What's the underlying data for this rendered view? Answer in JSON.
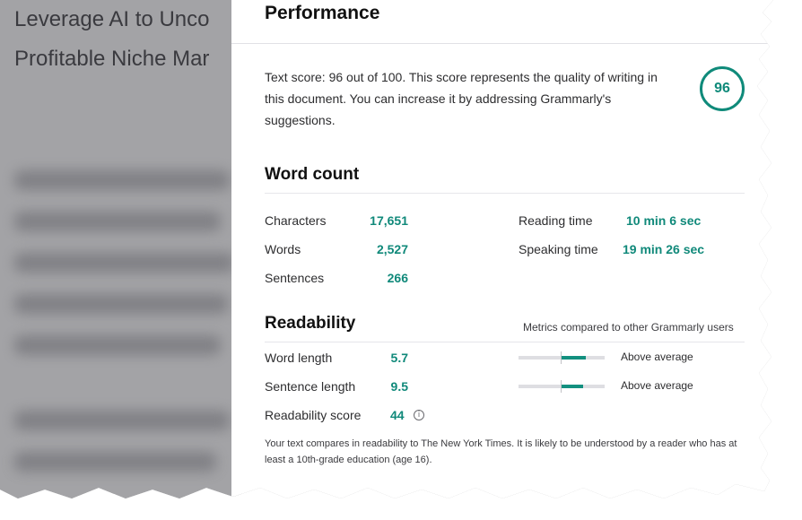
{
  "document": {
    "title_line1": "Leverage AI to Unco",
    "title_line2": "Profitable Niche Mar"
  },
  "performance": {
    "title": "Performance",
    "score": "96",
    "description": "Text score: 96 out of 100. This score represents the quality of writing in this document. You can increase it by addressing Grammarly's suggestions."
  },
  "word_count": {
    "heading": "Word count",
    "characters": {
      "label": "Characters",
      "value": "17,651"
    },
    "words": {
      "label": "Words",
      "value": "2,527"
    },
    "sentences": {
      "label": "Sentences",
      "value": "266"
    },
    "reading_time": {
      "label": "Reading time",
      "value": "10 min 6 sec"
    },
    "speaking_time": {
      "label": "Speaking time",
      "value": "19 min 26 sec"
    }
  },
  "readability": {
    "heading": "Readability",
    "compare_note": "Metrics compared to other Grammarly users",
    "word_length": {
      "label": "Word length",
      "value": "5.7",
      "rating": "Above average",
      "level": 0.78
    },
    "sentence_length": {
      "label": "Sentence length",
      "value": "9.5",
      "rating": "Above average",
      "level": 0.75
    },
    "score": {
      "label": "Readability score",
      "value": "44"
    },
    "footnote": "Your text compares in readability to The New York Times. It is likely to be understood by a reader who has at least a 10th-grade education (age 16)."
  },
  "colors": {
    "accent": "#10897a"
  }
}
